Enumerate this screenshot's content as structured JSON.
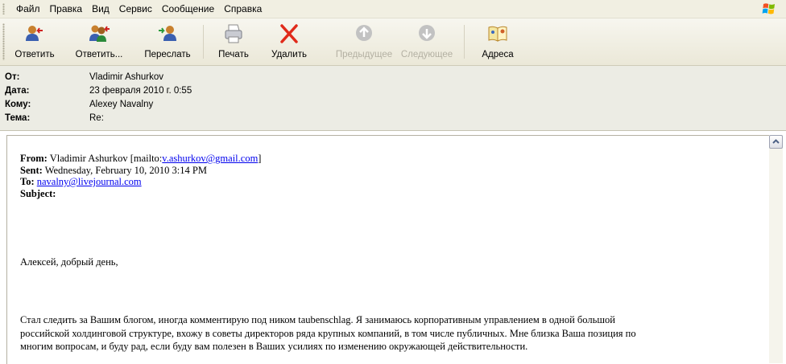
{
  "menu": {
    "items": [
      "Файл",
      "Правка",
      "Вид",
      "Сервис",
      "Сообщение",
      "Справка"
    ]
  },
  "toolbar": {
    "buttons": [
      {
        "label": "Ответить",
        "icon": "reply-icon",
        "enabled": true
      },
      {
        "label": "Ответить...",
        "icon": "reply-all-icon",
        "enabled": true
      },
      {
        "label": "Переслать",
        "icon": "forward-icon",
        "enabled": true
      },
      {
        "label": "Печать",
        "icon": "printer-icon",
        "enabled": true
      },
      {
        "label": "Удалить",
        "icon": "delete-icon",
        "enabled": true
      },
      {
        "label": "Предыдущее",
        "icon": "previous-icon",
        "enabled": false
      },
      {
        "label": "Следующее",
        "icon": "next-icon",
        "enabled": false
      },
      {
        "label": "Адреса",
        "icon": "address-book-icon",
        "enabled": true
      }
    ]
  },
  "headers": {
    "from_label": "От:",
    "from_value": "Vladimir Ashurkov",
    "date_label": "Дата:",
    "date_value": "23 февраля 2010 г. 0:55",
    "to_label": "Кому:",
    "to_value": "Alexey Navalny",
    "subject_label": "Тема:",
    "subject_value": "Re:"
  },
  "quoted": {
    "from_label": "From:",
    "from_text": "Vladimir Ashurkov [mailto:",
    "from_email": "v.ashurkov@gmail.com",
    "from_close": "]",
    "sent_label": "Sent:",
    "sent_value": "Wednesday, February 10, 2010 3:14 PM",
    "to_label": "To:",
    "to_email": "navalny@livejournal.com",
    "subject_label": "Subject:"
  },
  "body": {
    "greeting": "Алексей, добрый день,",
    "paragraph_lines": [
      "Стал следить за Вашим блогом, иногда комментирую под ником taubenschlag.  Я занимаюсь корпоративным управлением в одной большой",
      "российской холдинговой структуре, вхожу в советы директоров ряда крупных компаний, в том числе публичных.  Мне близка Ваша позиция по",
      "многим вопросам, и буду рад, если буду вам полезен в Ваших усилиях по изменению окружающей действительности."
    ]
  },
  "colors": {
    "menubar_bg": "#f1efe2",
    "header_bg": "#ecece4",
    "link": "#0000ee",
    "disabled_text": "#b3b0a2"
  }
}
